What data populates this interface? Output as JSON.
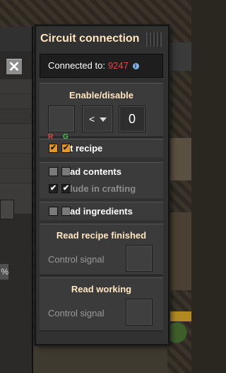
{
  "panel": {
    "title": "Circuit connection",
    "connected_label": "Connected to:",
    "connected_id": "9247",
    "info_icon": "i"
  },
  "left": {
    "close_glyph": "✕",
    "pct_text": "%"
  },
  "enable_disable": {
    "title": "Enable/disable",
    "comparator": "<",
    "constant": "0",
    "r_label": "R",
    "g_label": "G"
  },
  "options": [
    {
      "label": "t recipe",
      "red": true,
      "green": true,
      "style": "orange",
      "dim": false
    },
    {
      "label": "ad contents",
      "red": false,
      "green": false,
      "style": "grey",
      "dim": false
    },
    {
      "label": "lude in crafting",
      "red": true,
      "green": true,
      "style": "dark",
      "dim": true
    },
    {
      "label": "ad ingredients",
      "red": false,
      "green": false,
      "style": "grey",
      "dim": false
    }
  ],
  "read_recipe": {
    "title": "Read recipe finished",
    "signal_label": "Control signal"
  },
  "read_working": {
    "title": "Read working",
    "signal_label": "Control signal"
  },
  "colors": {
    "title": "#ffe6c0",
    "signal_id": "#e04848",
    "check_orange": "#e39826"
  }
}
